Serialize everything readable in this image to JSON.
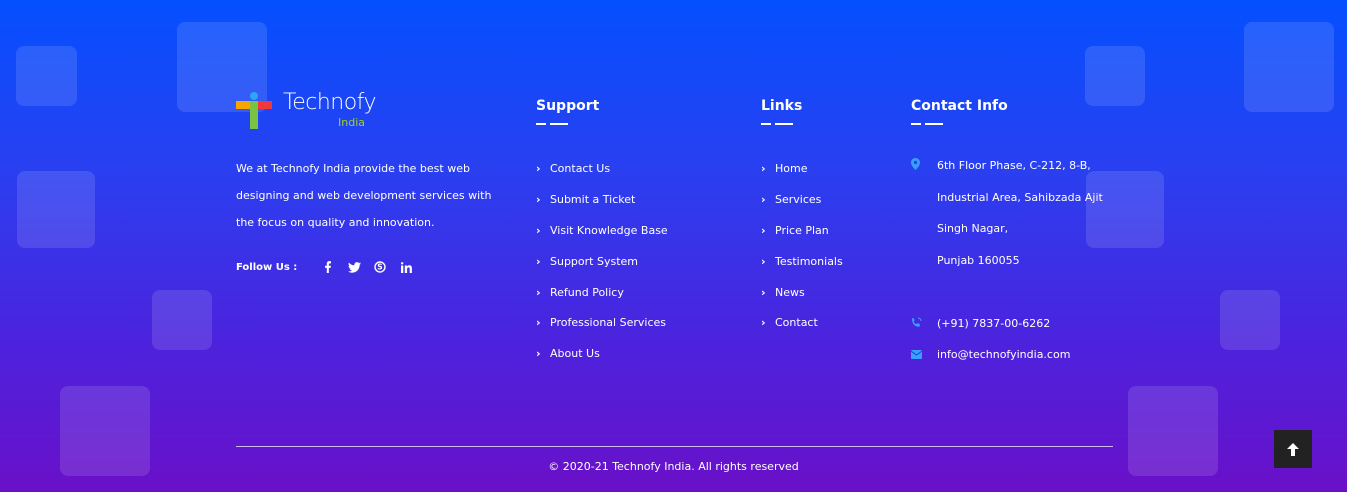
{
  "brand": {
    "name": "Technofy",
    "sub": "India"
  },
  "about": {
    "text": "We at Technofy India provide the best web designing and web development services with the focus on quality and innovation.",
    "follow_label": "Follow Us :"
  },
  "social": [
    "facebook-icon",
    "twitter-icon",
    "skype-icon",
    "linkedin-icon"
  ],
  "support": {
    "title": "Support",
    "items": [
      "Contact Us",
      "Submit a Ticket",
      "Visit Knowledge Base",
      "Support System",
      "Refund Policy",
      "Professional Services",
      "About Us"
    ]
  },
  "links": {
    "title": "Links",
    "items": [
      "Home",
      "Services",
      "Price Plan",
      "Testimonials",
      "News",
      "Contact"
    ]
  },
  "contact": {
    "title": "Contact Info",
    "address": [
      "6th Floor Phase, C-212, 8-B,",
      "Industrial Area, Sahibzada Ajit",
      "Singh Nagar,",
      "Punjab 160055"
    ],
    "phone": "(+91) 7837-00-6262",
    "email": "info@technofyindia.com"
  },
  "footer": {
    "copyright": "© 2020-21 Technofy India. All rights reserved"
  },
  "colors": {
    "accent": "#3aa0ff",
    "logo_green": "#9cd12a"
  }
}
